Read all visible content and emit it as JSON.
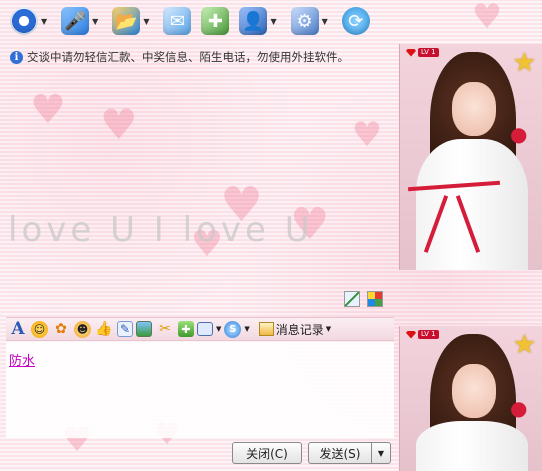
{
  "toolbar": {
    "buttons": [
      {
        "icon": "webcam-icon",
        "color": "#2b6bd6",
        "has_arrow": true
      },
      {
        "icon": "microphone-icon",
        "color": "#2b7fe0",
        "has_arrow": true
      },
      {
        "icon": "folder-transfer-icon",
        "color": "#2b8be6",
        "has_arrow": true
      },
      {
        "icon": "mail-icon",
        "color": "#5aa3e8",
        "has_arrow": false
      },
      {
        "icon": "add-app-icon",
        "color": "#4a9a3a",
        "has_arrow": false
      },
      {
        "icon": "contact-card-icon",
        "color": "#3067b8",
        "has_arrow": true
      },
      {
        "icon": "settings-icon",
        "color": "#4c7fc9",
        "has_arrow": true
      },
      {
        "icon": "refresh-icon",
        "color": "#2f9ae0",
        "has_arrow": false
      }
    ]
  },
  "notice": {
    "text": "交谈中请勿轻信汇款、中奖信息、陌生电话，勿使用外挂软件。"
  },
  "history": {
    "watermark": "love U  I love U"
  },
  "input_toolbar": {
    "font_label": "A",
    "message_record_label": "消息记录"
  },
  "input": {
    "text": "防水"
  },
  "buttons": {
    "close_label": "关闭(C)",
    "send_label": "发送(S)"
  },
  "profile": {
    "level_label": "LV 1",
    "level_number": "1"
  },
  "colors": {
    "background": "#fbe6ec",
    "accent": "#d51d3a",
    "input_text": "#c400c4"
  }
}
